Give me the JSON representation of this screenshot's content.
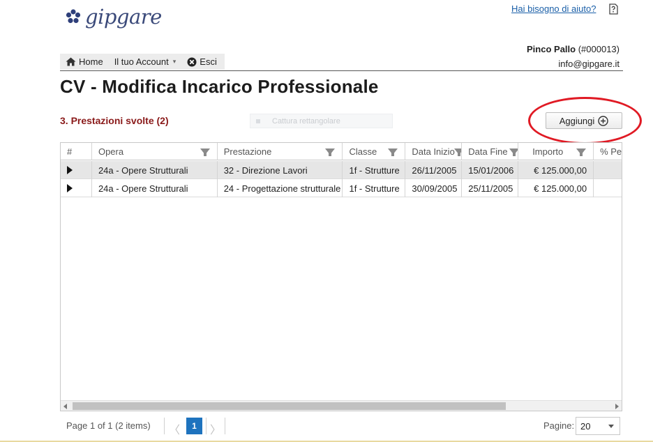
{
  "brand": {
    "logo_text": "gipgare",
    "accent": "#3b4a7a"
  },
  "header": {
    "help_link": "Hai bisogno di aiuto?",
    "help_icon": "help-question-icon",
    "user_name": "Pinco Pallo",
    "user_code": "(#000013)",
    "user_email": "info@gipgare.it"
  },
  "nav": {
    "home": "Home",
    "account": "Il tuo Account",
    "logout": "Esci"
  },
  "page": {
    "title": "CV - Modifica Incarico Professionale",
    "section_title": "3. Prestazioni svolte (2)",
    "ghost_text": "Cattura rettangolare",
    "add_button": "Aggiungi"
  },
  "grid": {
    "columns": [
      "#",
      "Opera",
      "Prestazione",
      "Classe",
      "Data Inizio",
      "Data Fine",
      "Importo",
      "% Pe"
    ],
    "rows": [
      {
        "opera": "24a - Opere Strutturali",
        "prestazione": "32 - Direzione Lavori",
        "classe": "1f - Strutture",
        "data_inizio": "26/11/2005",
        "data_fine": "15/01/2006",
        "importo": "€ 125.000,00"
      },
      {
        "opera": "24a - Opere Strutturali",
        "prestazione": "24 - Progettazione strutturale",
        "classe": "1f - Strutture",
        "data_inizio": "30/09/2005",
        "data_fine": "25/11/2005",
        "importo": "€ 125.000,00"
      }
    ]
  },
  "pager": {
    "info": "Page 1 of 1 (2 items)",
    "current_page": "1",
    "prev": "〈",
    "next": "〉",
    "page_size_label": "Pagine:",
    "page_size": "20"
  },
  "colors": {
    "section_title": "#8a1a1a",
    "pager_active": "#1e73be",
    "highlight_ellipse": "#e01a24"
  }
}
